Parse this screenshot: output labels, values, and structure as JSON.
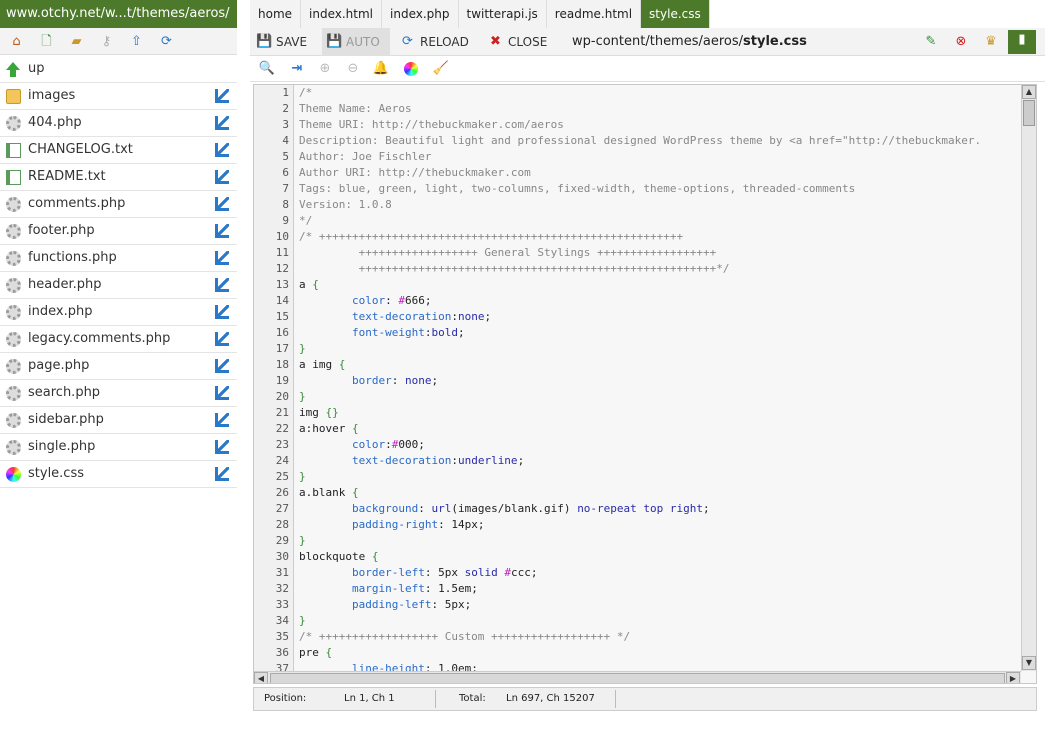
{
  "site": {
    "title": "www.otchy.net/w...t/themes/aeros/"
  },
  "left_toolbar": {
    "icons": [
      "home-icon",
      "new-file-icon",
      "new-folder-icon",
      "key-icon",
      "upload-icon",
      "refresh-icon"
    ]
  },
  "files": [
    {
      "name": "up",
      "icon": "up-arrow-icon",
      "kind": "up"
    },
    {
      "name": "images",
      "icon": "folder-icon",
      "kind": "folder"
    },
    {
      "name": "404.php",
      "icon": "gear-icon",
      "kind": "php"
    },
    {
      "name": "CHANGELOG.txt",
      "icon": "text-file-icon",
      "kind": "txt"
    },
    {
      "name": "README.txt",
      "icon": "text-file-icon",
      "kind": "txt"
    },
    {
      "name": "comments.php",
      "icon": "gear-icon",
      "kind": "php"
    },
    {
      "name": "footer.php",
      "icon": "gear-icon",
      "kind": "php"
    },
    {
      "name": "functions.php",
      "icon": "gear-icon",
      "kind": "php"
    },
    {
      "name": "header.php",
      "icon": "gear-icon",
      "kind": "php"
    },
    {
      "name": "index.php",
      "icon": "gear-icon",
      "kind": "php"
    },
    {
      "name": "legacy.comments.php",
      "icon": "gear-icon",
      "kind": "php"
    },
    {
      "name": "page.php",
      "icon": "gear-icon",
      "kind": "php"
    },
    {
      "name": "search.php",
      "icon": "gear-icon",
      "kind": "php"
    },
    {
      "name": "sidebar.php",
      "icon": "gear-icon",
      "kind": "php"
    },
    {
      "name": "single.php",
      "icon": "gear-icon",
      "kind": "php"
    },
    {
      "name": "style.css",
      "icon": "color-wheel-icon",
      "kind": "css"
    }
  ],
  "tabs": [
    {
      "label": "home",
      "active": false
    },
    {
      "label": "index.html",
      "active": false
    },
    {
      "label": "index.php",
      "active": false
    },
    {
      "label": "twitterapi.js",
      "active": false
    },
    {
      "label": "readme.html",
      "active": false
    },
    {
      "label": "style.css",
      "active": true
    }
  ],
  "toolbar": {
    "save_label": "SAVE",
    "auto_label": "AUTO",
    "reload_label": "RELOAD",
    "close_label": "CLOSE",
    "path_prefix": "wp-content/themes/aeros/",
    "path_file": "style.css"
  },
  "right_buttons": [
    "edit-icon",
    "delete-icon",
    "crown-icon",
    "panel-toggle-icon"
  ],
  "search_tools": [
    "search-icon",
    "goto-line-icon",
    "find-next-icon",
    "find-prev-icon",
    "bell-icon",
    "color-picker-icon",
    "broom-icon"
  ],
  "editor": {
    "first_line": 1,
    "lines": [
      [
        [
          "cmt",
          "/*"
        ]
      ],
      [
        [
          "cmt",
          "Theme Name: Aeros"
        ]
      ],
      [
        [
          "cmt",
          "Theme URI: http://thebuckmaker.com/aeros"
        ]
      ],
      [
        [
          "cmt",
          "Description: Beautiful light and professional designed WordPress theme by <a href=\"http://thebuckmaker."
        ]
      ],
      [
        [
          "cmt",
          "Author: Joe Fischler"
        ]
      ],
      [
        [
          "cmt",
          "Author URI: http://thebuckmaker.com"
        ]
      ],
      [
        [
          "cmt",
          "Tags: blue, green, light, two-columns, fixed-width, theme-options, threaded-comments"
        ]
      ],
      [
        [
          "cmt",
          "Version: 1.0.8"
        ]
      ],
      [
        [
          "cmt",
          "*/"
        ]
      ],
      [
        [
          "cmt",
          "/* +++++++++++++++++++++++++++++++++++++++++++++++++++++++"
        ]
      ],
      [
        [
          "cmt",
          "         ++++++++++++++++++ General Stylings ++++++++++++++++++"
        ]
      ],
      [
        [
          "cmt",
          "         ++++++++++++++++++++++++++++++++++++++++++++++++++++++*/"
        ]
      ],
      [
        [
          "sel",
          "a "
        ],
        [
          "brace",
          "{"
        ]
      ],
      [
        [
          "prop",
          "        color"
        ],
        [
          "sel",
          ": "
        ],
        [
          "hash",
          "#"
        ],
        [
          "num",
          "666"
        ],
        [
          "sel",
          ";"
        ]
      ],
      [
        [
          "prop",
          "        text-decoration"
        ],
        [
          "sel",
          ":"
        ],
        [
          "val",
          "none"
        ],
        [
          "sel",
          ";"
        ]
      ],
      [
        [
          "prop",
          "        font-weight"
        ],
        [
          "sel",
          ":"
        ],
        [
          "val",
          "bold"
        ],
        [
          "sel",
          ";"
        ]
      ],
      [
        [
          "brace",
          "}"
        ]
      ],
      [
        [
          "sel",
          "a img "
        ],
        [
          "brace",
          "{"
        ]
      ],
      [
        [
          "prop",
          "        border"
        ],
        [
          "sel",
          ": "
        ],
        [
          "val",
          "none"
        ],
        [
          "sel",
          ";"
        ]
      ],
      [
        [
          "brace",
          "}"
        ]
      ],
      [
        [
          "sel",
          "img "
        ],
        [
          "brace",
          "{}"
        ]
      ],
      [
        [
          "sel",
          "a:hover "
        ],
        [
          "brace",
          "{"
        ]
      ],
      [
        [
          "prop",
          "        color"
        ],
        [
          "sel",
          ":"
        ],
        [
          "hash",
          "#"
        ],
        [
          "num",
          "000"
        ],
        [
          "sel",
          ";"
        ]
      ],
      [
        [
          "prop",
          "        text-decoration"
        ],
        [
          "sel",
          ":"
        ],
        [
          "val",
          "underline"
        ],
        [
          "sel",
          ";"
        ]
      ],
      [
        [
          "brace",
          "}"
        ]
      ],
      [
        [
          "sel",
          "a.blank "
        ],
        [
          "brace",
          "{"
        ]
      ],
      [
        [
          "prop",
          "        background"
        ],
        [
          "sel",
          ": "
        ],
        [
          "val",
          "url"
        ],
        [
          "sel",
          "(images/blank.gif) "
        ],
        [
          "val",
          "no-repeat top right"
        ],
        [
          "sel",
          ";"
        ]
      ],
      [
        [
          "prop",
          "        padding-right"
        ],
        [
          "sel",
          ": "
        ],
        [
          "num",
          "14px"
        ],
        [
          "sel",
          ";"
        ]
      ],
      [
        [
          "brace",
          "}"
        ]
      ],
      [
        [
          "sel",
          "blockquote "
        ],
        [
          "brace",
          "{"
        ]
      ],
      [
        [
          "prop",
          "        border-left"
        ],
        [
          "sel",
          ": "
        ],
        [
          "num",
          "5px "
        ],
        [
          "val",
          "solid "
        ],
        [
          "hash",
          "#"
        ],
        [
          "num",
          "ccc"
        ],
        [
          "sel",
          ";"
        ]
      ],
      [
        [
          "prop",
          "        margin-left"
        ],
        [
          "sel",
          ": "
        ],
        [
          "num",
          "1.5em"
        ],
        [
          "sel",
          ";"
        ]
      ],
      [
        [
          "prop",
          "        padding-left"
        ],
        [
          "sel",
          ": "
        ],
        [
          "num",
          "5px"
        ],
        [
          "sel",
          ";"
        ]
      ],
      [
        [
          "brace",
          "}"
        ]
      ],
      [
        [
          "cmt",
          "/* ++++++++++++++++++ Custom ++++++++++++++++++ */"
        ]
      ],
      [
        [
          "sel",
          "pre "
        ],
        [
          "brace",
          "{"
        ]
      ],
      [
        [
          "prop",
          "        line-height"
        ],
        [
          "sel",
          ": "
        ],
        [
          "num",
          "1.0em"
        ],
        [
          "sel",
          ";"
        ]
      ]
    ]
  },
  "status": {
    "position_label": "Position:",
    "position_value": "Ln 1, Ch 1",
    "total_label": "Total:",
    "total_value": "Ln 697, Ch 15207"
  }
}
